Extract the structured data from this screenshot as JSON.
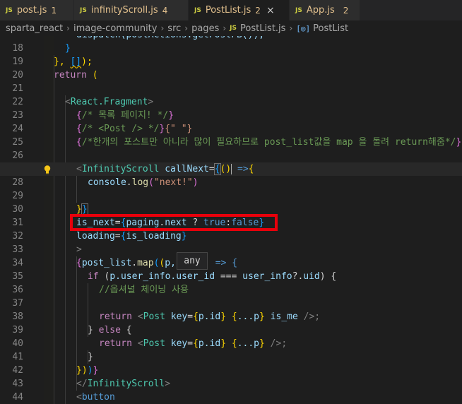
{
  "tabs": [
    {
      "icon": "JS",
      "name": "post.js",
      "count": "1"
    },
    {
      "icon": "JS",
      "name": "infinityScroll.js",
      "count": "4"
    },
    {
      "icon": "JS",
      "name": "PostList.js",
      "count": "2",
      "close": "×"
    },
    {
      "icon": "JS",
      "name": "App.js",
      "count": "2"
    }
  ],
  "breadcrumbs": [
    "sparta_react",
    "image-community",
    "src",
    "pages",
    "PostList.js",
    "PostList"
  ],
  "breadcrumb_icons": {
    "file": "JS",
    "symbol": "[◎]"
  },
  "tooltip": "any",
  "lines": [
    {
      "n": "18",
      "cur": false
    },
    {
      "n": "19",
      "cur": false
    },
    {
      "n": "20",
      "cur": false
    },
    {
      "n": "21",
      "cur": false
    },
    {
      "n": "22",
      "cur": false
    },
    {
      "n": "23",
      "cur": false
    },
    {
      "n": "24",
      "cur": false
    },
    {
      "n": "25",
      "cur": false
    },
    {
      "n": "26",
      "cur": false
    },
    {
      "n": "27",
      "cur": true
    },
    {
      "n": "28",
      "cur": false
    },
    {
      "n": "29",
      "cur": false
    },
    {
      "n": "30",
      "cur": false
    },
    {
      "n": "31",
      "cur": false
    },
    {
      "n": "32",
      "cur": false
    },
    {
      "n": "33",
      "cur": false
    },
    {
      "n": "34",
      "cur": false
    },
    {
      "n": "35",
      "cur": false
    },
    {
      "n": "36",
      "cur": false
    },
    {
      "n": "37",
      "cur": false
    },
    {
      "n": "38",
      "cur": false
    },
    {
      "n": "39",
      "cur": false
    },
    {
      "n": "40",
      "cur": false
    },
    {
      "n": "41",
      "cur": false
    },
    {
      "n": "42",
      "cur": false
    },
    {
      "n": "43",
      "cur": false
    },
    {
      "n": "44",
      "cur": false
    }
  ],
  "code": {
    "top_partial": "dispatch(postActions.getPostFB());",
    "l18": "}",
    "l19a": "}, ",
    "l19b": "[]",
    "l19c": ");",
    "l20a": "return",
    "l20b": " (",
    "l22a": "<",
    "l22b": "React.Fragment",
    "l22c": ">",
    "l23a": "{",
    "l23b": "/* 목록 페이지! */",
    "l23c": "}",
    "l24a": "{",
    "l24b": "/* <Post /> */",
    "l24c": "}",
    "l24d": "{\" \"}",
    "l25a": "{",
    "l25b": "/*한개의 포스트만 아니라 많이 필요하므로 post_list값을 map 을 돌려 return해줌*/",
    "l25c": "}",
    "l27a": "<",
    "l27b": "InfinityScroll",
    "l27c": " callNext",
    "l27d": "=",
    "l27e": "{",
    "l27f": "()",
    "l27g": " =>",
    "l27h": "{",
    "l28a": "console",
    "l28b": ".",
    "l28c": "log",
    "l28d": "(",
    "l28e": "\"next!\"",
    "l28f": ")",
    "l30a": "}",
    "l30b": "}",
    "l31a": "is_next",
    "l31b": "=",
    "l31c": "{",
    "l31d": "paging",
    "l31e": ".",
    "l31f": "next",
    "l31g": " ? ",
    "l31h": "true",
    "l31i": ":",
    "l31j": "false",
    "l31k": "}",
    "l32a": "loading",
    "l32b": "=",
    "l32c": "{",
    "l32d": "is_loading",
    "l32e": "}",
    "l33": ">",
    "l34a": "{",
    "l34b": "post_list",
    "l34c": ".",
    "l34d": "map",
    "l34e": "(",
    "l34f": "(",
    "l34g": "p,",
    "l34h": " => {",
    "l35a": "if",
    "l35b": " (",
    "l35c": "p",
    "l35d": ".user_info.",
    "l35e": "user_id",
    "l35f": " === ",
    "l35g": "user_info",
    "l35h": "?.",
    "l35i": "uid",
    "l35j": ") {",
    "l36": "//옵셔널 체이닝 사용",
    "l38a": "return",
    "l38b": " <",
    "l38c": "Post",
    "l38d": " key",
    "l38e": "=",
    "l38f": "{",
    "l38g": "p.id",
    "l38h": "}",
    "l38i": " {",
    "l38j": "...p",
    "l38k": "}",
    "l38l": " is_me",
    "l38m": " />;",
    "l39a": "} ",
    "l39b": "else",
    "l39c": " {",
    "l40a": "return",
    "l40b": " <",
    "l40c": "Post",
    "l40d": " key",
    "l40e": "=",
    "l40f": "{",
    "l40g": "p.id",
    "l40h": "}",
    "l40i": " {",
    "l40j": "...p",
    "l40k": "}",
    "l40l": " />;",
    "l41": "}",
    "l42a": "}",
    "l42b": ")",
    "l42c": ")",
    "l42d": "}",
    "l43a": "</",
    "l43b": "InfinityScroll",
    "l43c": ">",
    "l44a": "<",
    "l44b": "button"
  },
  "colors": {
    "editor_bg": "#1e1e1e",
    "highlight_box": "#e8000b",
    "tab_modified": "#e2c08d"
  }
}
